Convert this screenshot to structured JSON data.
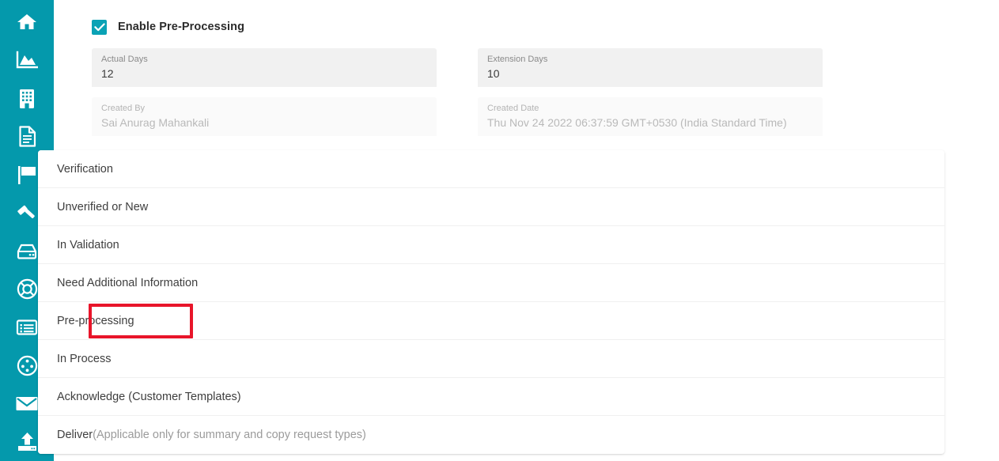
{
  "sidebar": {
    "background_color": "#0499ac",
    "items": [
      {
        "icon": "home-icon",
        "name": "sidebar-item-home"
      },
      {
        "icon": "chart-area-icon",
        "name": "sidebar-item-analytics"
      },
      {
        "icon": "building-icon",
        "name": "sidebar-item-organization"
      },
      {
        "icon": "document-icon",
        "name": "sidebar-item-documents"
      },
      {
        "icon": "flag-icon",
        "name": "sidebar-item-flags"
      },
      {
        "icon": "gavel-icon",
        "name": "sidebar-item-legal"
      },
      {
        "icon": "server-icon",
        "name": "sidebar-item-storage"
      },
      {
        "icon": "life-ring-icon",
        "name": "sidebar-item-support"
      },
      {
        "icon": "list-table-icon",
        "name": "sidebar-item-reports"
      },
      {
        "icon": "network-circle-icon",
        "name": "sidebar-item-integrations"
      },
      {
        "icon": "envelope-icon",
        "name": "sidebar-item-mail"
      },
      {
        "icon": "upload-icon",
        "name": "sidebar-item-upload"
      }
    ]
  },
  "form": {
    "enable_preprocessing": {
      "label": "Enable Pre-Processing",
      "checked": true,
      "check_color": "#0aa2b5"
    },
    "fields": [
      {
        "label": "Actual Days",
        "value": "12",
        "disabled": false
      },
      {
        "label": "Extension Days",
        "value": "10",
        "disabled": false
      },
      {
        "label": "Created By",
        "value": "Sai Anurag Mahankali",
        "disabled": true
      },
      {
        "label": "Created Date",
        "value": "Thu Nov 24 2022 06:37:59 GMT+0530 (India Standard Time)",
        "disabled": true
      }
    ]
  },
  "status_list": {
    "items": [
      {
        "label": "Verification",
        "suffix": "",
        "highlighted": false
      },
      {
        "label": "Unverified or New",
        "suffix": "",
        "highlighted": false
      },
      {
        "label": "In Validation",
        "suffix": "",
        "highlighted": false
      },
      {
        "label": "Need Additional Information",
        "suffix": "",
        "highlighted": false
      },
      {
        "label": "Pre-processing",
        "suffix": "",
        "highlighted": true
      },
      {
        "label": "In Process",
        "suffix": "",
        "highlighted": false
      },
      {
        "label": "Acknowledge (Customer Templates)",
        "suffix": "",
        "highlighted": false
      },
      {
        "label": "Deliver",
        "suffix": "(Applicable only for summary and copy request types)",
        "highlighted": false
      }
    ]
  },
  "annotation": {
    "highlight_color": "#e8152a",
    "target_label": "Pre-processing"
  }
}
